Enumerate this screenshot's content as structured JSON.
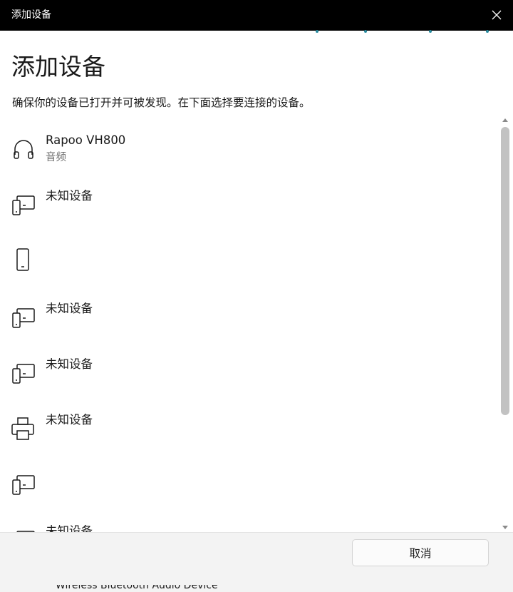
{
  "window": {
    "title": "添加设备"
  },
  "dialog": {
    "heading": "添加设备",
    "instruction": "确保你的设备已打开并可被发现。在下面选择要连接的设备。"
  },
  "devices": [
    {
      "icon": "headphones-icon",
      "name": "Rapoo VH800",
      "category": "音频"
    },
    {
      "icon": "generic-device-icon",
      "name": "未知设备",
      "category": ""
    },
    {
      "icon": "phone-icon",
      "name": "",
      "category": ""
    },
    {
      "icon": "generic-device-icon",
      "name": "未知设备",
      "category": ""
    },
    {
      "icon": "generic-device-icon",
      "name": "未知设备",
      "category": ""
    },
    {
      "icon": "printer-icon",
      "name": "未知设备",
      "category": ""
    },
    {
      "icon": "generic-device-icon",
      "name": "",
      "category": ""
    },
    {
      "icon": "generic-device-icon",
      "name": "未知设备",
      "category": ""
    }
  ],
  "footer": {
    "cancel_label": "取消"
  },
  "background": {
    "peek_text": "Wireless Bluetooth Audio Device"
  },
  "colors": {
    "titlebar": "#000000",
    "accent_dots": "#2a8ca0",
    "footer": "#f3f3f3"
  }
}
